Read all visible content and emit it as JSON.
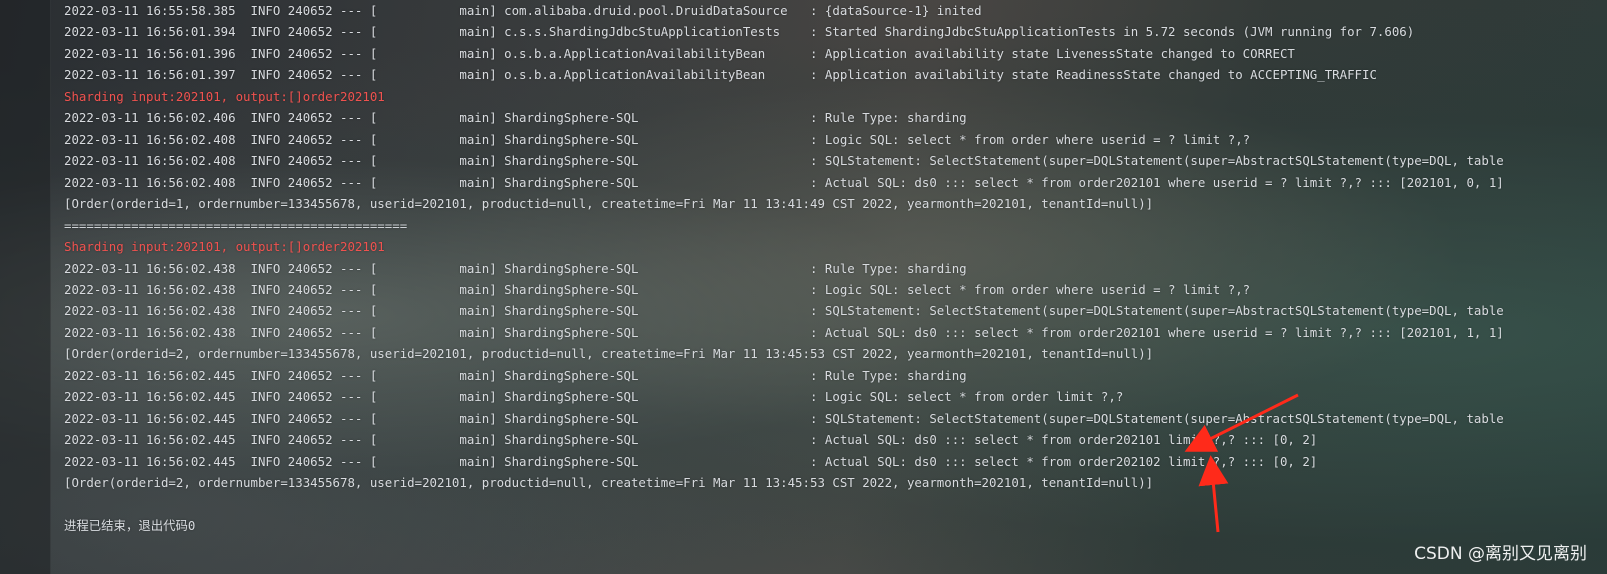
{
  "console": {
    "lines": [
      {
        "kind": "log",
        "text": "2022-03-11 16:55:58.385  INFO 240652 --- [           main] com.alibaba.druid.pool.DruidDataSource   : {dataSource-1} inited"
      },
      {
        "kind": "log",
        "text": "2022-03-11 16:56:01.394  INFO 240652 --- [           main] c.s.s.ShardingJdbcStuApplicationTests    : Started ShardingJdbcStuApplicationTests in 5.72 seconds (JVM running for 7.606)"
      },
      {
        "kind": "log",
        "text": "2022-03-11 16:56:01.396  INFO 240652 --- [           main] o.s.b.a.ApplicationAvailabilityBean      : Application availability state LivenessState changed to CORRECT"
      },
      {
        "kind": "log",
        "text": "2022-03-11 16:56:01.397  INFO 240652 --- [           main] o.s.b.a.ApplicationAvailabilityBean      : Application availability state ReadinessState changed to ACCEPTING_TRAFFIC"
      },
      {
        "kind": "err",
        "text": "Sharding input:202101, output:[]order202101"
      },
      {
        "kind": "log",
        "text": "2022-03-11 16:56:02.406  INFO 240652 --- [           main] ShardingSphere-SQL                       : Rule Type: sharding"
      },
      {
        "kind": "log",
        "text": "2022-03-11 16:56:02.408  INFO 240652 --- [           main] ShardingSphere-SQL                       : Logic SQL: select * from order where userid = ? limit ?,?"
      },
      {
        "kind": "log",
        "text": "2022-03-11 16:56:02.408  INFO 240652 --- [           main] ShardingSphere-SQL                       : SQLStatement: SelectStatement(super=DQLStatement(super=AbstractSQLStatement(type=DQL, table"
      },
      {
        "kind": "log",
        "text": "2022-03-11 16:56:02.408  INFO 240652 --- [           main] ShardingSphere-SQL                       : Actual SQL: ds0 ::: select * from order202101 where userid = ? limit ?,? ::: [202101, 0, 1]"
      },
      {
        "kind": "log",
        "text": "[Order(orderid=1, ordernumber=133455678, userid=202101, productid=null, createtime=Fri Mar 11 13:41:49 CST 2022, yearmonth=202101, tenantId=null)]"
      },
      {
        "kind": "sep",
        "text": "=============================================="
      },
      {
        "kind": "err",
        "text": "Sharding input:202101, output:[]order202101"
      },
      {
        "kind": "log",
        "text": "2022-03-11 16:56:02.438  INFO 240652 --- [           main] ShardingSphere-SQL                       : Rule Type: sharding"
      },
      {
        "kind": "log",
        "text": "2022-03-11 16:56:02.438  INFO 240652 --- [           main] ShardingSphere-SQL                       : Logic SQL: select * from order where userid = ? limit ?,?"
      },
      {
        "kind": "log",
        "text": "2022-03-11 16:56:02.438  INFO 240652 --- [           main] ShardingSphere-SQL                       : SQLStatement: SelectStatement(super=DQLStatement(super=AbstractSQLStatement(type=DQL, table"
      },
      {
        "kind": "log",
        "text": "2022-03-11 16:56:02.438  INFO 240652 --- [           main] ShardingSphere-SQL                       : Actual SQL: ds0 ::: select * from order202101 where userid = ? limit ?,? ::: [202101, 1, 1]"
      },
      {
        "kind": "log",
        "text": "[Order(orderid=2, ordernumber=133455678, userid=202101, productid=null, createtime=Fri Mar 11 13:45:53 CST 2022, yearmonth=202101, tenantId=null)]"
      },
      {
        "kind": "log",
        "text": "2022-03-11 16:56:02.445  INFO 240652 --- [           main] ShardingSphere-SQL                       : Rule Type: sharding"
      },
      {
        "kind": "log",
        "text": "2022-03-11 16:56:02.445  INFO 240652 --- [           main] ShardingSphere-SQL                       : Logic SQL: select * from order limit ?,?"
      },
      {
        "kind": "log",
        "text": "2022-03-11 16:56:02.445  INFO 240652 --- [           main] ShardingSphere-SQL                       : SQLStatement: SelectStatement(super=DQLStatement(super=AbstractSQLStatement(type=DQL, table"
      },
      {
        "kind": "log",
        "text": "2022-03-11 16:56:02.445  INFO 240652 --- [           main] ShardingSphere-SQL                       : Actual SQL: ds0 ::: select * from order202101 limit ?,? ::: [0, 2]"
      },
      {
        "kind": "log",
        "text": "2022-03-11 16:56:02.445  INFO 240652 --- [           main] ShardingSphere-SQL                       : Actual SQL: ds0 ::: select * from order202102 limit ?,? ::: [0, 2]"
      },
      {
        "kind": "log",
        "text": "[Order(orderid=2, ordernumber=133455678, userid=202101, productid=null, createtime=Fri Mar 11 13:45:53 CST 2022, yearmonth=202101, tenantId=null)]"
      },
      {
        "kind": "blank",
        "text": ""
      },
      {
        "kind": "exit",
        "text": "进程已结束，退出代码0"
      }
    ]
  },
  "watermark": "CSDN @离别又见离别",
  "colors": {
    "log_text": "#d8dbdf",
    "error_text": "#f0524f",
    "annotation_arrow": "#ff2a1a"
  },
  "annotations": [
    {
      "icon": "red-arrow-icon",
      "points_to": "order202101"
    },
    {
      "icon": "red-arrow-icon",
      "points_to": "order202102"
    }
  ]
}
